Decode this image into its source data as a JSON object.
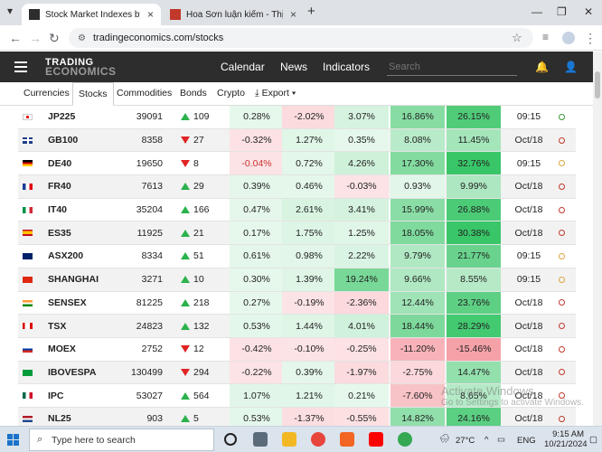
{
  "browser": {
    "tabs": [
      {
        "title": "Stock Market Indexes by Count"
      },
      {
        "title": "Hoa Sơn luận kiếm - Thị trường"
      }
    ],
    "url": "tradingeconomics.com/stocks"
  },
  "site": {
    "logo_line1": "TRADING",
    "logo_line2": "ECONOMICS",
    "nav": [
      "Calendar",
      "News",
      "Indicators"
    ],
    "search_placeholder": "Search"
  },
  "subnav": {
    "items": [
      "Currencies",
      "Stocks",
      "Commodities",
      "Bonds",
      "Crypto"
    ],
    "active": "Stocks",
    "export_label": "Export"
  },
  "table": {
    "rows": [
      {
        "name": "JP225",
        "flag": "jp",
        "price": "39091",
        "dir": "up",
        "chg": "109",
        "p": [
          "0.28%",
          "-2.02%",
          "3.07%",
          "16.86%",
          "26.15%"
        ],
        "date": "09:15"
      },
      {
        "name": "GB100",
        "flag": "gb",
        "price": "8358",
        "dir": "down",
        "chg": "27",
        "p": [
          "-0.32%",
          "1.27%",
          "0.35%",
          "8.08%",
          "11.45%"
        ],
        "date": "Oct/18"
      },
      {
        "name": "DE40",
        "flag": "de",
        "price": "19650",
        "dir": "down",
        "chg": "8",
        "p": [
          "-0.04%",
          "0.72%",
          "4.26%",
          "17.30%",
          "32.76%"
        ],
        "date": "09:15"
      },
      {
        "name": "FR40",
        "flag": "fr",
        "price": "7613",
        "dir": "up",
        "chg": "29",
        "p": [
          "0.39%",
          "0.46%",
          "-0.03%",
          "0.93%",
          "9.99%"
        ],
        "date": "Oct/18"
      },
      {
        "name": "IT40",
        "flag": "it",
        "price": "35204",
        "dir": "up",
        "chg": "166",
        "p": [
          "0.47%",
          "2.61%",
          "3.41%",
          "15.99%",
          "26.88%"
        ],
        "date": "Oct/18"
      },
      {
        "name": "ES35",
        "flag": "es",
        "price": "11925",
        "dir": "up",
        "chg": "21",
        "p": [
          "0.17%",
          "1.75%",
          "1.25%",
          "18.05%",
          "30.38%"
        ],
        "date": "Oct/18"
      },
      {
        "name": "ASX200",
        "flag": "au",
        "price": "8334",
        "dir": "up",
        "chg": "51",
        "p": [
          "0.61%",
          "0.98%",
          "2.22%",
          "9.79%",
          "21.77%"
        ],
        "date": "09:15"
      },
      {
        "name": "SHANGHAI",
        "flag": "cn",
        "price": "3271",
        "dir": "up",
        "chg": "10",
        "p": [
          "0.30%",
          "1.39%",
          "19.24%",
          "9.66%",
          "8.55%"
        ],
        "date": "09:15"
      },
      {
        "name": "SENSEX",
        "flag": "in",
        "price": "81225",
        "dir": "up",
        "chg": "218",
        "p": [
          "0.27%",
          "-0.19%",
          "-2.36%",
          "12.44%",
          "23.76%"
        ],
        "date": "Oct/18"
      },
      {
        "name": "TSX",
        "flag": "ca",
        "price": "24823",
        "dir": "up",
        "chg": "132",
        "p": [
          "0.53%",
          "1.44%",
          "4.01%",
          "18.44%",
          "28.29%"
        ],
        "date": "Oct/18"
      },
      {
        "name": "MOEX",
        "flag": "ru",
        "price": "2752",
        "dir": "down",
        "chg": "12",
        "p": [
          "-0.42%",
          "-0.10%",
          "-0.25%",
          "-11.20%",
          "-15.46%"
        ],
        "date": "Oct/18"
      },
      {
        "name": "IBOVESPA",
        "flag": "br",
        "price": "130499",
        "dir": "down",
        "chg": "294",
        "p": [
          "-0.22%",
          "0.39%",
          "-1.97%",
          "-2.75%",
          "14.47%"
        ],
        "date": "Oct/18"
      },
      {
        "name": "IPC",
        "flag": "mx",
        "price": "53027",
        "dir": "up",
        "chg": "564",
        "p": [
          "1.07%",
          "1.21%",
          "0.21%",
          "-7.60%",
          "8.65%"
        ],
        "date": "Oct/18"
      },
      {
        "name": "NL25",
        "flag": "nl",
        "price": "903",
        "dir": "up",
        "chg": "5",
        "p": [
          "0.53%",
          "-1.37%",
          "-0.55%",
          "14.82%",
          "24.16%"
        ],
        "date": "Oct/18"
      }
    ]
  },
  "watermark": {
    "line1": "Activate Windows",
    "line2": "Go to Settings to activate Windows."
  },
  "taskbar": {
    "search_placeholder": "Type here to search",
    "temperature": "27°C",
    "language": "ENG",
    "time": "9:15 AM",
    "date": "10/21/2024"
  },
  "colors": {
    "up": "#2bb24c",
    "down": "#e02424",
    "header_bg": "#2d2d2d"
  }
}
